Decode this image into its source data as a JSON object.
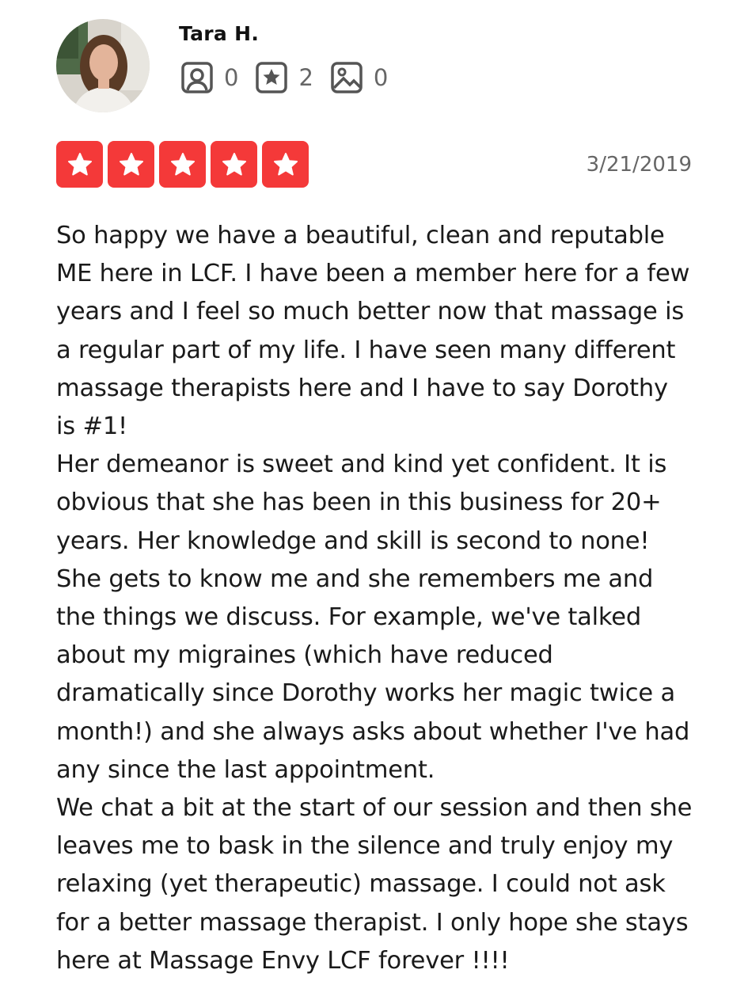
{
  "user": {
    "name": "Tara H.",
    "stats": [
      {
        "icon": "friends-icon",
        "count": "0"
      },
      {
        "icon": "review-star-icon",
        "count": "2"
      },
      {
        "icon": "photos-icon",
        "count": "0"
      }
    ]
  },
  "review": {
    "rating": 5,
    "rating_max": 5,
    "star_color": "#f43939",
    "date": "3/21/2019",
    "paragraphs": [
      "So happy we have a beautiful, clean and reputable ME here in LCF. I have been a member here for a few years and I feel so much better now that massage is a regular part of my life. I have seen many different massage therapists here and I have to say Dorothy is #1!",
      "Her demeanor is sweet and kind yet confident. It is obvious that she has been in this business for 20+ years. Her knowledge and skill is second to none! She gets to know me and she remembers me and the things we discuss. For example, we've talked about my migraines (which have reduced dramatically since Dorothy works her magic twice a month!) and she always asks about whether I've had any since the last appointment.",
      "We chat a bit at the start of our session and then she leaves me to bask in the silence and truly enjoy my relaxing (yet therapeutic) massage. I could not ask for a better massage therapist. I only hope she stays here at Massage Envy LCF forever !!!!"
    ]
  }
}
